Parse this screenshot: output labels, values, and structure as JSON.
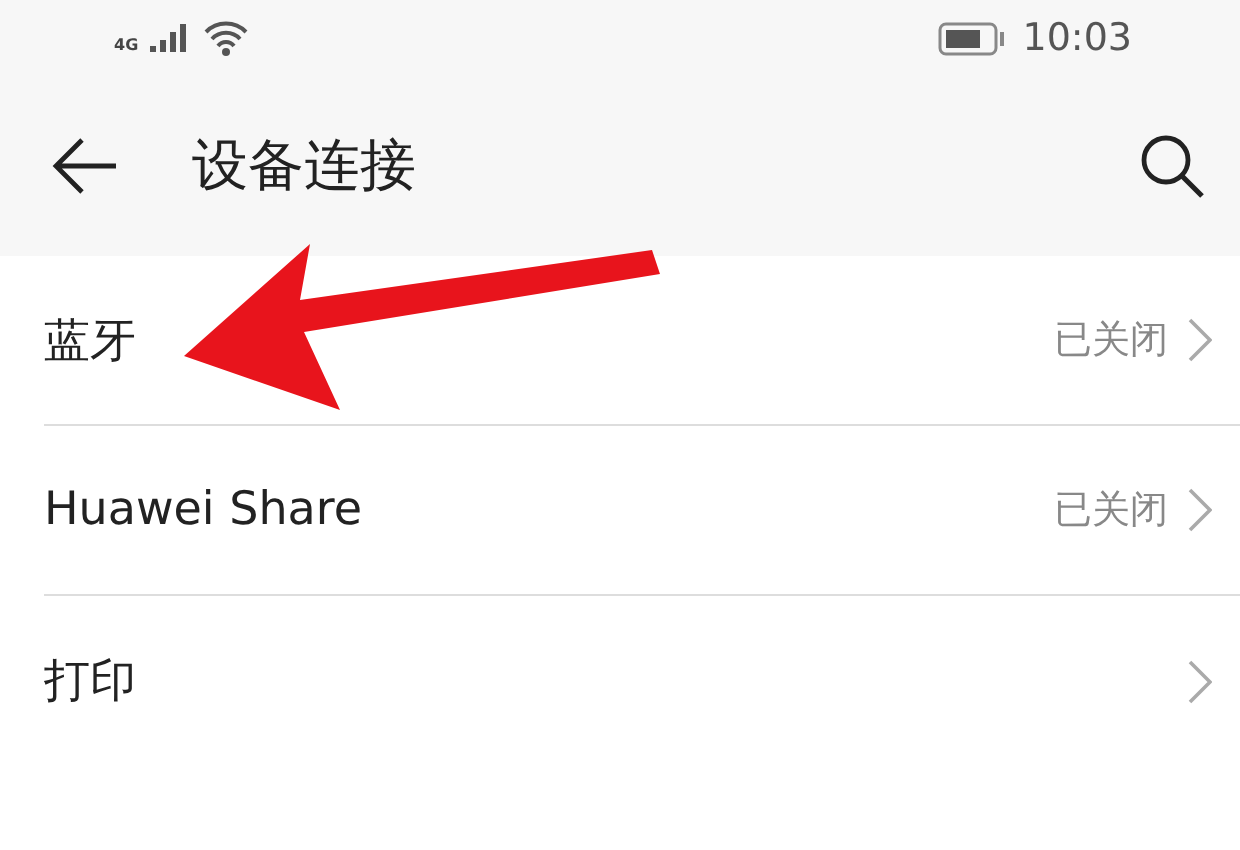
{
  "status_bar": {
    "network": "4G",
    "time": "10:03"
  },
  "header": {
    "title": "设备连接"
  },
  "items": [
    {
      "label": "蓝牙",
      "status": "已关闭"
    },
    {
      "label": "Huawei Share",
      "status": "已关闭"
    },
    {
      "label": "打印"
    }
  ],
  "annotation": {
    "kind": "arrow"
  }
}
